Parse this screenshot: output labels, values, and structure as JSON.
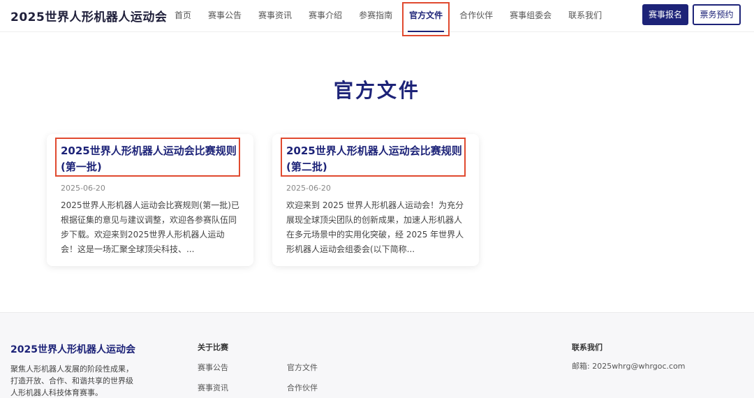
{
  "header": {
    "brand": "2025世界人形机器人运动会",
    "nav": [
      "首页",
      "赛事公告",
      "赛事资讯",
      "赛事介绍",
      "参赛指南",
      "官方文件",
      "合作伙伴",
      "赛事组委会",
      "联系我们"
    ],
    "active_nav": "官方文件",
    "register_label": "赛事报名",
    "ticket_label": "票务预约"
  },
  "main": {
    "title": "官方文件",
    "cards": [
      {
        "title": "2025世界人形机器人运动会比赛规则(第一批)",
        "date": "2025-06-20",
        "excerpt": "2025世界人形机器人运动会比赛规则(第一批)已根据征集的意见与建议调整，欢迎各参赛队伍同步下载。欢迎来到2025世界人形机器人运动会！这是一场汇聚全球顶尖科技、..."
      },
      {
        "title": "2025世界人形机器人运动会比赛规则(第二批)",
        "date": "2025-06-20",
        "excerpt": "欢迎来到 2025 世界人形机器人运动会！为充分展现全球顶尖团队的创新成果，加速人形机器人在多元场景中的实用化突破，经 2025 年世界人形机器人运动会组委会(以下简称..."
      }
    ]
  },
  "footer": {
    "brand": "2025世界人形机器人运动会",
    "description": "聚焦人形机器人发展的阶段性成果，打造开放、合作、和谐共享的世界级人形机器人科技体育赛事。",
    "about_title": "关于比赛",
    "about_links": [
      "赛事公告",
      "官方文件",
      "赛事资讯",
      "合作伙伴"
    ],
    "contact_title": "联系我们",
    "email": "邮箱: 2025whrg@whrgoc.com"
  },
  "colors": {
    "brand_navy": "#1d2378",
    "highlight_red": "#e04a2f"
  }
}
